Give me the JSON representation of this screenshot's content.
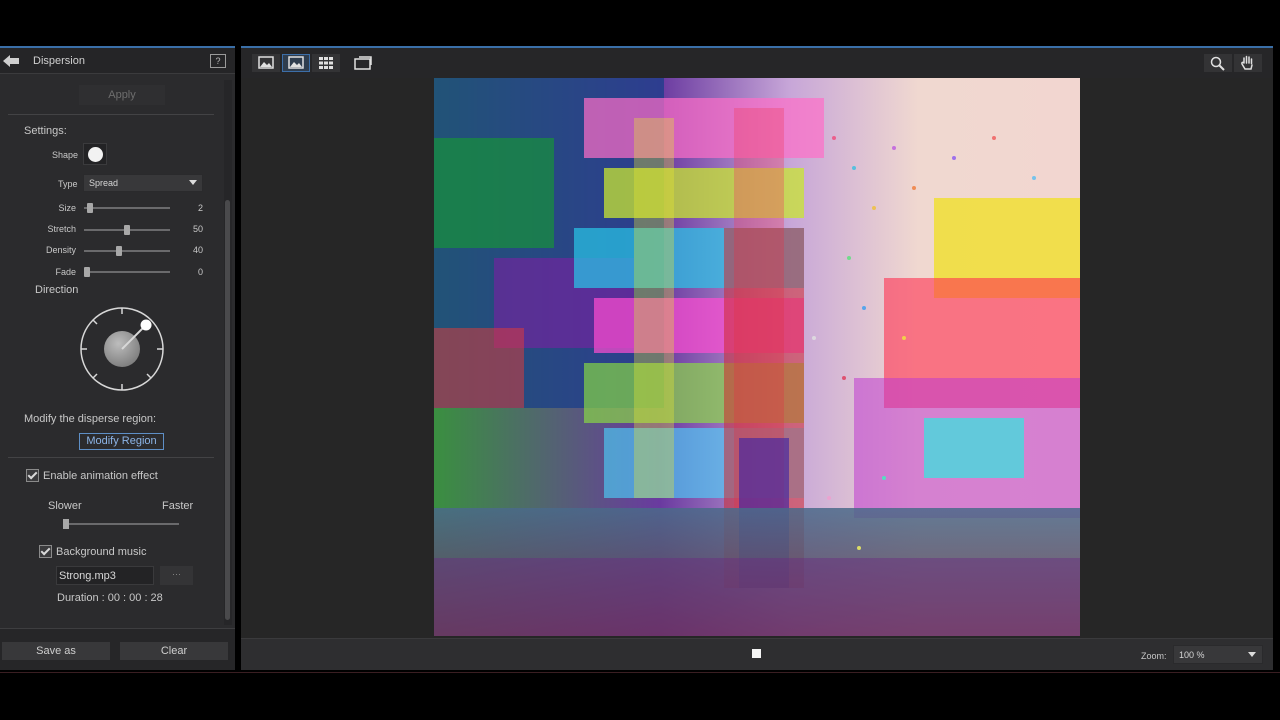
{
  "panel": {
    "title": "Dispersion",
    "help_icon_text": "?",
    "apply_label": "Apply",
    "settings_label": "Settings:",
    "shape_label": "Shape",
    "type_label": "Type",
    "type_value": "Spread",
    "sliders": [
      {
        "label": "Size",
        "value": "2",
        "fraction": 0.04
      },
      {
        "label": "Stretch",
        "value": "50",
        "fraction": 0.5
      },
      {
        "label": "Density",
        "value": "40",
        "fraction": 0.4
      },
      {
        "label": "Fade",
        "value": "0",
        "fraction": 0.0
      }
    ],
    "direction_label": "Direction",
    "direction_angle_deg": 45,
    "modify_desc": "Modify the disperse region:",
    "modify_region_label": "Modify Region",
    "animation_label": "Enable animation effect",
    "animation_checked": true,
    "slower_label": "Slower",
    "faster_label": "Faster",
    "speed_fraction": 0.0,
    "music_label": "Background music",
    "music_checked": true,
    "music_file": "Strong.mp3",
    "browse_label": "···",
    "duration_label": "Duration : 00 : 00 : 28",
    "save_as_label": "Save as",
    "clear_label": "Clear"
  },
  "toolbar": {
    "icons": [
      "image-view-icon",
      "image-view-active-icon",
      "grid-view-icon",
      "compare-view-icon",
      "magnifier-icon",
      "hand-pan-icon"
    ]
  },
  "playback": {
    "zoom_label": "Zoom:",
    "zoom_value": "100 %"
  },
  "colors": {
    "accent": "#3a6fa8",
    "panel_bg": "#2b2b2d",
    "link_blue": "#8cb4e6"
  }
}
